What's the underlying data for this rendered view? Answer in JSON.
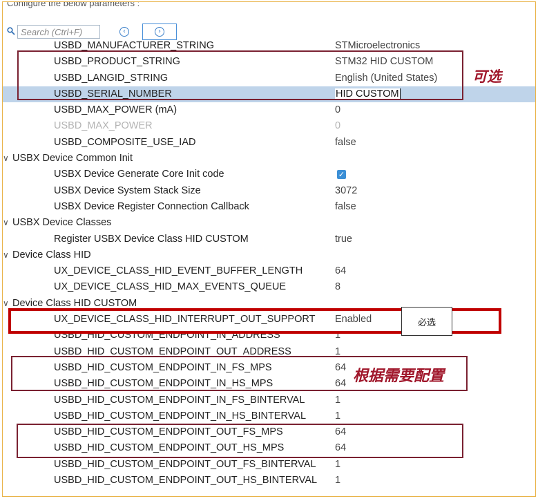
{
  "header": {
    "text": "Configure the below parameters :"
  },
  "search": {
    "placeholder": "Search (Ctrl+F)"
  },
  "rows": [
    {
      "type": "child",
      "label": "USBD_MANUFACTURER_STRING",
      "value": "STMicroelectronics"
    },
    {
      "type": "child",
      "label": "USBD_PRODUCT_STRING",
      "value": "STM32 HID CUSTOM"
    },
    {
      "type": "child",
      "label": "USBD_LANGID_STRING",
      "value": "English (United States)"
    },
    {
      "type": "child",
      "label": "USBD_SERIAL_NUMBER",
      "value": "HID CUSTOM",
      "selected": true
    },
    {
      "type": "child",
      "label": "USBD_MAX_POWER (mA)",
      "value": "0"
    },
    {
      "type": "child",
      "label": "USBD_MAX_POWER",
      "value": "0",
      "disabled": true
    },
    {
      "type": "child",
      "label": "USBD_COMPOSITE_USE_IAD",
      "value": "false"
    },
    {
      "type": "group",
      "label": "USBX Device Common Init"
    },
    {
      "type": "child",
      "label": "USBX Device Generate Core Init code",
      "checkbox": true,
      "checked": true
    },
    {
      "type": "child",
      "label": "USBX Device System Stack Size",
      "value": "3072"
    },
    {
      "type": "child",
      "label": "USBX Device Register Connection Callback",
      "value": "false"
    },
    {
      "type": "group",
      "label": "USBX Device Classes"
    },
    {
      "type": "child",
      "label": "Register USBX Device Class HID CUSTOM",
      "value": "true"
    },
    {
      "type": "group",
      "label": "Device Class HID"
    },
    {
      "type": "child",
      "label": "UX_DEVICE_CLASS_HID_EVENT_BUFFER_LENGTH",
      "value": "64"
    },
    {
      "type": "child",
      "label": "UX_DEVICE_CLASS_HID_MAX_EVENTS_QUEUE",
      "value": "8"
    },
    {
      "type": "group",
      "label": "Device Class HID CUSTOM"
    },
    {
      "type": "child",
      "label": "UX_DEVICE_CLASS_HID_INTERRUPT_OUT_SUPPORT",
      "value": "Enabled"
    },
    {
      "type": "child",
      "label": "USBD_HID_CUSTOM_ENDPOINT_IN_ADDRESS",
      "value": "1"
    },
    {
      "type": "child",
      "label": "USBD_HID_CUSTOM_ENDPOINT_OUT_ADDRESS",
      "value": "1"
    },
    {
      "type": "child",
      "label": "USBD_HID_CUSTOM_ENDPOINT_IN_FS_MPS",
      "value": "64"
    },
    {
      "type": "child",
      "label": "USBD_HID_CUSTOM_ENDPOINT_IN_HS_MPS",
      "value": "64"
    },
    {
      "type": "child",
      "label": "USBD_HID_CUSTOM_ENDPOINT_IN_FS_BINTERVAL",
      "value": "1"
    },
    {
      "type": "child",
      "label": "USBD_HID_CUSTOM_ENDPOINT_IN_HS_BINTERVAL",
      "value": "1"
    },
    {
      "type": "child",
      "label": "USBD_HID_CUSTOM_ENDPOINT_OUT_FS_MPS",
      "value": "64"
    },
    {
      "type": "child",
      "label": "USBD_HID_CUSTOM_ENDPOINT_OUT_HS_MPS",
      "value": "64"
    },
    {
      "type": "child",
      "label": "USBD_HID_CUSTOM_ENDPOINT_OUT_FS_BINTERVAL",
      "value": "1"
    },
    {
      "type": "child",
      "label": "USBD_HID_CUSTOM_ENDPOINT_OUT_HS_BINTERVAL",
      "value": "1"
    }
  ],
  "annotations": {
    "optional": "可选",
    "required": "必选",
    "as_needed": "根据需要配置"
  },
  "icons": {
    "search": "search-icon",
    "prev": "chevron-left-circle-icon",
    "next": "chevron-right-circle-icon",
    "expand": "chevron-down-icon",
    "check": "checkmark-icon"
  },
  "colors": {
    "selection": "#bfd4ea",
    "annotation_box": "#7a2131",
    "required_box": "#c00000",
    "annotation_text": "#a0172b",
    "checkbox": "#3b8fd6"
  }
}
